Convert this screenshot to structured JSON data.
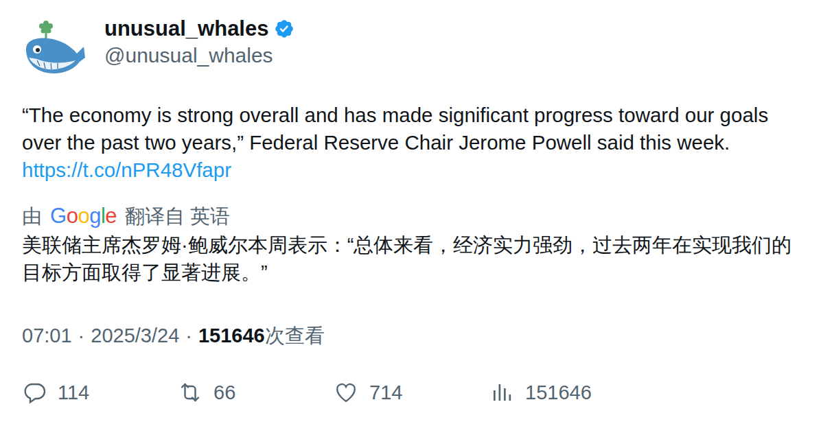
{
  "author": {
    "name": "unusual_whales",
    "handle": "@unusual_whales",
    "verified": true
  },
  "tweet": {
    "text": "“The economy is strong overall and has made significant progress toward our goals over the past two years,” Federal Reserve Chair Jerome Powell said this week. ",
    "link": "https://t.co/nPR48Vfapr"
  },
  "translation": {
    "prefix": "由",
    "provider": "Google",
    "suffix": "翻译自 英语",
    "text": "美联储主席杰罗姆·鲍威尔本周表示：“总体来看，经济实力强劲，过去两年在实现我们的目标方面取得了显著进展。”"
  },
  "meta": {
    "time": "07:01",
    "separators": [
      "·",
      "·"
    ],
    "date": "2025/3/24",
    "views": "151646",
    "views_label": "次查看"
  },
  "actions": [
    {
      "kind": "reply",
      "count": "114"
    },
    {
      "kind": "retweet",
      "count": "66"
    },
    {
      "kind": "like",
      "count": "714"
    },
    {
      "kind": "views",
      "count": "151646"
    }
  ]
}
